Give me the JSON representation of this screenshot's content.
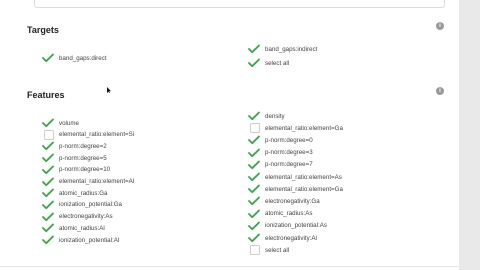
{
  "targets": {
    "title": "Targets",
    "options": [
      {
        "label": "band_gaps:direct",
        "checked": true
      },
      {
        "label": "band_gaps:indirect",
        "checked": true
      },
      {
        "label": "select all",
        "checked": true
      }
    ]
  },
  "features": {
    "title": "Features",
    "left": [
      {
        "label": "volume",
        "checked": true
      },
      {
        "label": "elemental_ratio:element=Si",
        "checked": false
      },
      {
        "label": "p-norm:degree=2",
        "checked": true
      },
      {
        "label": "p-norm:degree=5",
        "checked": true
      },
      {
        "label": "p-norm:degree=10",
        "checked": true
      },
      {
        "label": "elemental_ratio:element=Al",
        "checked": true
      },
      {
        "label": "atomic_radius:Ga",
        "checked": true
      },
      {
        "label": "ionization_potential:Ga",
        "checked": true
      },
      {
        "label": "electronegativity:As",
        "checked": true
      },
      {
        "label": "atomic_radius:Al",
        "checked": true
      },
      {
        "label": "ionization_potential:Al",
        "checked": true
      }
    ],
    "right": [
      {
        "label": "density",
        "checked": true
      },
      {
        "label": "elemental_ratio:element=Ga",
        "checked": false
      },
      {
        "label": "p-norm:degree=0",
        "checked": true
      },
      {
        "label": "p-norm:degree=3",
        "checked": true
      },
      {
        "label": "p-norm:degree=7",
        "checked": true
      },
      {
        "label": "elemental_ratio:element=As",
        "checked": true
      },
      {
        "label": "elemental_ratio:element=Ga",
        "checked": true
      },
      {
        "label": "electronegativity:Ga",
        "checked": true
      },
      {
        "label": "atomic_radius:As",
        "checked": true
      },
      {
        "label": "ionization_potential:As",
        "checked": true
      },
      {
        "label": "electronegativity:Al",
        "checked": true
      },
      {
        "label": "select all",
        "checked": false
      }
    ]
  },
  "icons": {
    "check": "checkmark-icon",
    "info": "info-icon"
  },
  "colors": {
    "check": "#3aa64a",
    "info": "#9a9a9a",
    "scrollbar": "#e9e9e9"
  }
}
